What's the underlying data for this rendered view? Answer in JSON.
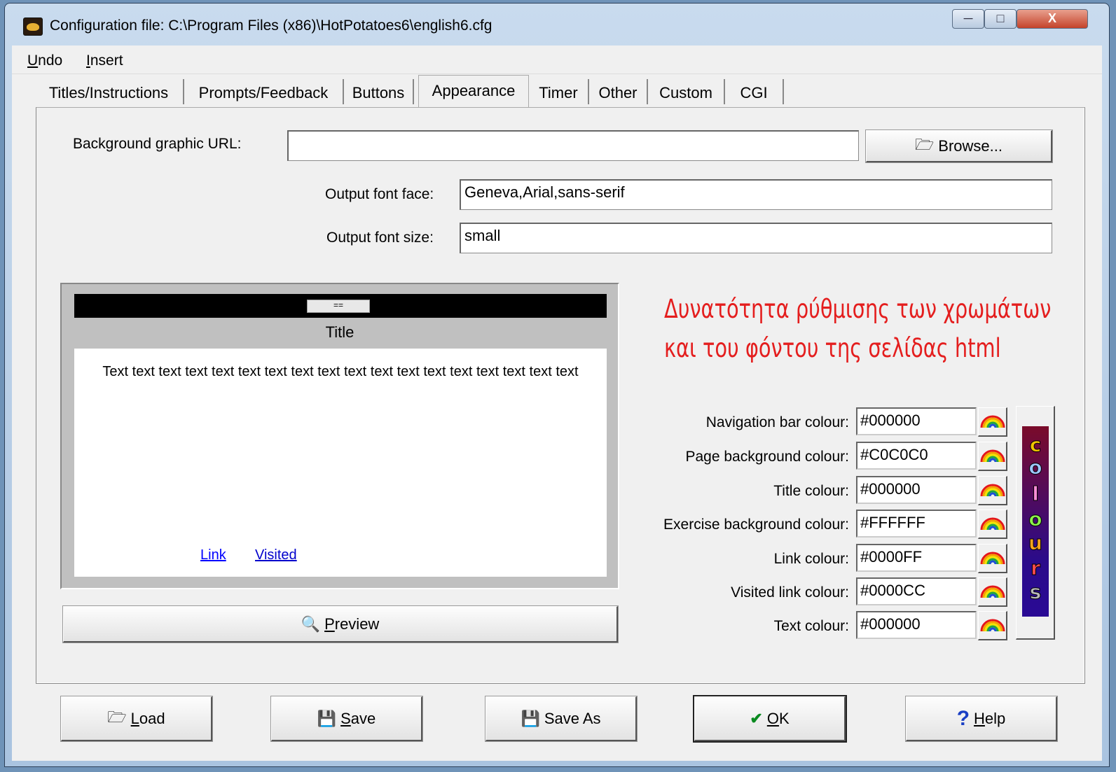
{
  "window": {
    "title": "Configuration file: C:\\Program Files (x86)\\HotPotatoes6\\english6.cfg",
    "min_glyph": "─",
    "max_glyph": "□",
    "close_glyph": "X"
  },
  "menu": {
    "undo": "Undo",
    "insert": "Insert"
  },
  "tabs": [
    "Titles/Instructions",
    "Prompts/Feedback",
    "Buttons",
    "Appearance",
    "Timer",
    "Other",
    "Custom",
    "CGI"
  ],
  "active_tab": "Appearance",
  "appearance": {
    "bg_url_label": "Background graphic URL:",
    "bg_url_value": "",
    "browse_label": "Browse...",
    "font_face_label": "Output font face:",
    "font_face_value": "Geneva,Arial,sans-serif",
    "font_size_label": "Output font size:",
    "font_size_value": "small",
    "preview_label": "Preview"
  },
  "preview": {
    "nav_button": "==",
    "title": "Title",
    "text": "Text text text text text text text text text text text text text text text text text text",
    "link": "Link",
    "visited": "Visited"
  },
  "annotation": {
    "line1": "Δυνατότητα ρύθμισης των χρωμάτων",
    "line2": "και του φόντου της σελίδας html"
  },
  "colours": [
    {
      "label": "Navigation bar colour:",
      "value": "#000000"
    },
    {
      "label": "Page background colour:",
      "value": "#C0C0C0"
    },
    {
      "label": "Title colour:",
      "value": "#000000"
    },
    {
      "label": "Exercise background colour:",
      "value": "#FFFFFF"
    },
    {
      "label": "Link colour:",
      "value": "#0000FF"
    },
    {
      "label": "Visited link colour:",
      "value": "#0000CC"
    },
    {
      "label": "Text colour:",
      "value": "#000000"
    }
  ],
  "colours_button_letters": [
    "c",
    "o",
    "l",
    "o",
    "u",
    "r",
    "s"
  ],
  "footer": {
    "load": "Load",
    "save": "Save",
    "save_as": "Save As",
    "ok": "OK",
    "help": "Help"
  }
}
